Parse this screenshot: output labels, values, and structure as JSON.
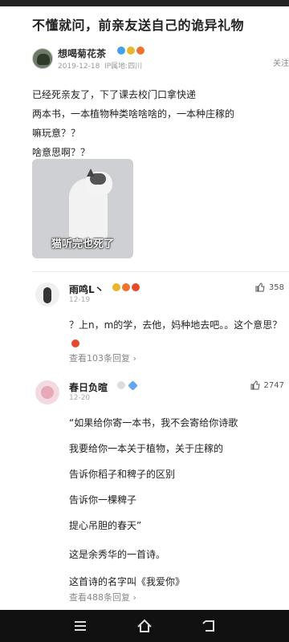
{
  "post": {
    "title": "不懂就问，前亲友送自己的诡异礼物",
    "author": {
      "name": "想喝菊花茶",
      "date": "2019-12-18",
      "location": "IP属地:四川"
    },
    "follow_label": "关注",
    "lines": [
      "已经死亲友了，下了课去校门口拿快递",
      "两本书，一本植物种类啥啥啥的，一本种庄稼的",
      "嘛玩意？？",
      "啥意思啊？？"
    ],
    "image_caption": "猫听完也死了"
  },
  "comments": [
    {
      "name": "雨鸣L丶",
      "date": "12-19",
      "likes": "358",
      "body": "？上n，m的学，去他，妈种地去吧。。这个意思？",
      "replies": "查看103条回复"
    },
    {
      "name": "春日负暄",
      "date": "12-20",
      "likes": "2747",
      "lines": [
        "“如果给你寄一本书，我不会寄给你诗歌",
        "我要给你一本关于植物，关于庄稼的",
        "告诉你稻子和稗子的区别",
        "告诉你一棵稗子",
        "提心吊胆的春天”",
        "这是余秀华的一首诗。",
        "这首诗的名字叫《我爱你》"
      ],
      "replies": "查看488条回复"
    }
  ],
  "icons": {
    "like": "thumb-up-icon",
    "nav_menu": "menu-icon",
    "nav_home": "home-icon",
    "nav_back": "back-icon"
  }
}
